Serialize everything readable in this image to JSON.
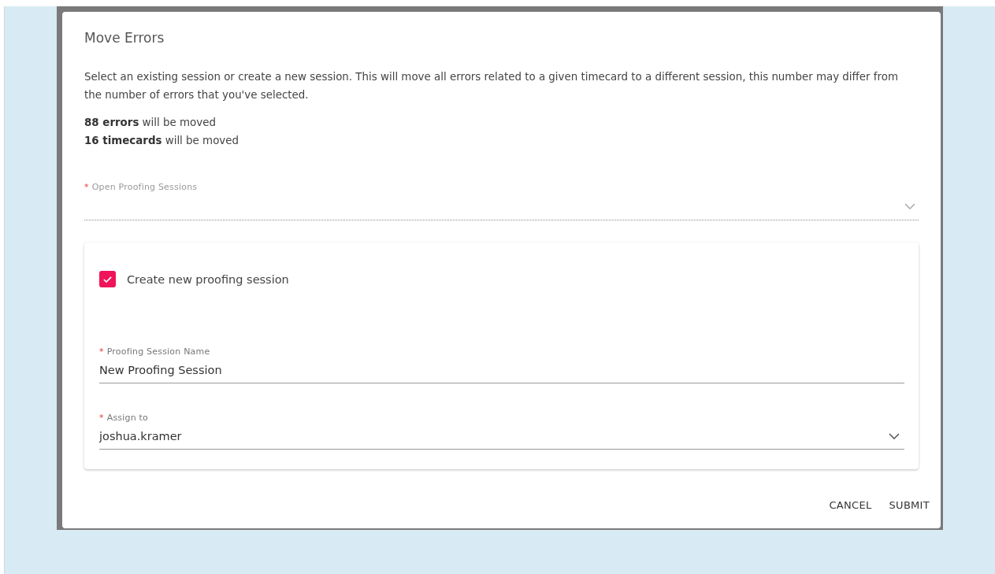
{
  "dialog": {
    "title": "Move Errors",
    "description": "Select an existing session or create a new session. This will move all errors related to a given timecard to a different session, this number may differ from the number of errors that you've selected.",
    "counts": [
      "**88 errors** will be moved",
      "**16 timecards** will be moved"
    ],
    "session_select": {
      "label": "Open Proofing Sessions",
      "required_mark": "*"
    },
    "new_session": {
      "label": "Create new proofing session",
      "checked": true,
      "fields": [
        {
          "kind": "text",
          "label": "Proofing Session Name",
          "required_mark": "*",
          "value": "New Proofing Session"
        },
        {
          "kind": "select",
          "label": "Assign to",
          "required_mark": "*",
          "value": "joshua.kramer"
        }
      ]
    },
    "buttons": [
      "CANCEL",
      "SUBMIT"
    ]
  }
}
